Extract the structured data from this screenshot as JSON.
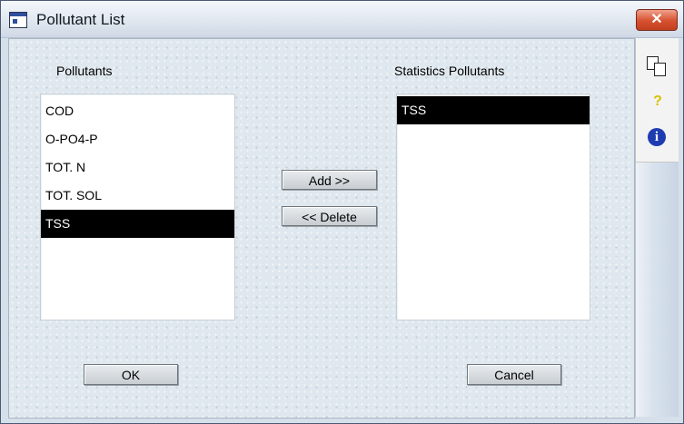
{
  "window": {
    "title": "Pollutant List",
    "close_glyph": "✕"
  },
  "pollutants": {
    "label": "Pollutants",
    "items": [
      {
        "label": "COD",
        "selected": false
      },
      {
        "label": "O-PO4-P",
        "selected": false
      },
      {
        "label": "TOT. N",
        "selected": false
      },
      {
        "label": "TOT. SOL",
        "selected": false
      },
      {
        "label": "TSS",
        "selected": true
      }
    ]
  },
  "statistics": {
    "label": "Statistics Pollutants",
    "items": [
      {
        "label": "TSS",
        "selected": true
      }
    ]
  },
  "buttons": {
    "add": "Add >>",
    "delete": "<< Delete",
    "ok": "OK",
    "cancel": "Cancel"
  },
  "toolbar": {
    "icons": [
      "copy-icon",
      "help-icon",
      "info-icon"
    ],
    "help_glyph": "?",
    "info_glyph": "i"
  },
  "colors": {
    "selection": "#000000",
    "close_button": "#d6502f",
    "info_icon": "#1f3bb0"
  }
}
